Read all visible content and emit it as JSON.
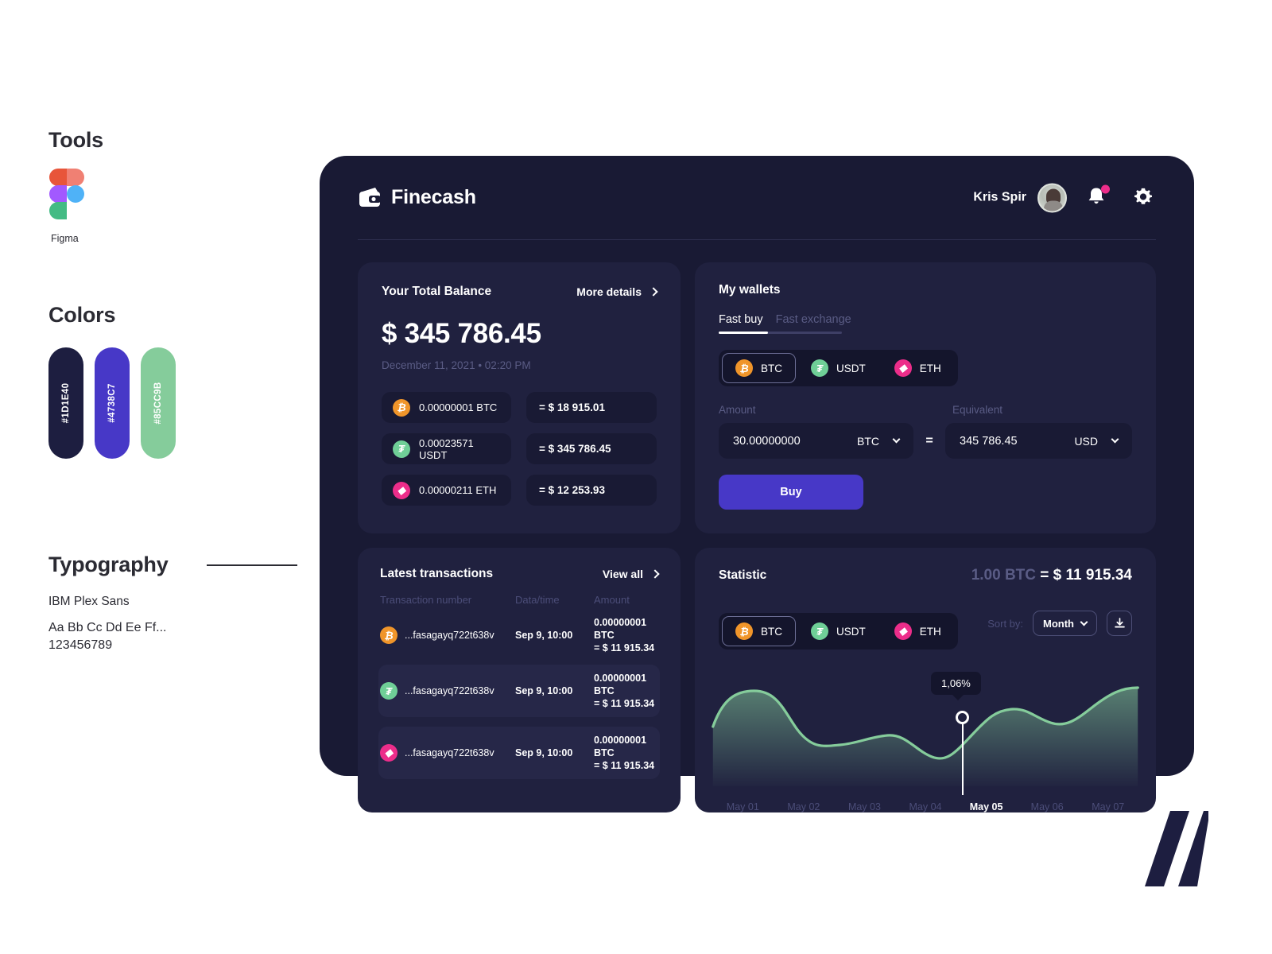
{
  "spec": {
    "tools_title": "Tools",
    "tool_name": "Figma",
    "colors_title": "Colors",
    "swatches": [
      {
        "hex": "#1D1E40",
        "label": "#1D1E40"
      },
      {
        "hex": "#4738C7",
        "label": "#4738C7"
      },
      {
        "hex": "#85CC9B",
        "label": "#85CC9B"
      }
    ],
    "typography_title": "Typography",
    "font_name": "IBM Plex Sans",
    "font_sample_line1": "Aa Bb Cc Dd Ee Ff...",
    "font_sample_line2": "123456789"
  },
  "header": {
    "brand": "Finecash",
    "user_name": "Kris Spir",
    "notification_badge": true
  },
  "balance": {
    "title": "Your Total Balance",
    "more_details": "More details",
    "amount": "$ 345 786.45",
    "datetime": "December 11, 2021 • 02:20 PM",
    "rows": [
      {
        "icon": "btc-icon",
        "symbol": "₿",
        "amount": "0.00000001 BTC",
        "equivalent": "= $ 18 915.01"
      },
      {
        "icon": "usdt-icon",
        "symbol": "₮",
        "amount": "0.00023571 USDT",
        "equivalent": "= $ 345 786.45"
      },
      {
        "icon": "eth-icon",
        "symbol": "◆",
        "amount": "0.00000211 ETH",
        "equivalent": "= $ 12 253.93"
      }
    ]
  },
  "wallets": {
    "title": "My wallets",
    "tabs": [
      {
        "label": "Fast buy",
        "active": true
      },
      {
        "label": "Fast exchange",
        "active": false
      }
    ],
    "coins": [
      {
        "label": "BTC",
        "symbol": "₿",
        "selected": true
      },
      {
        "label": "USDT",
        "symbol": "₮",
        "selected": false
      },
      {
        "label": "ETH",
        "symbol": "◆",
        "selected": false
      }
    ],
    "amount_label": "Amount",
    "equivalent_label": "Equivalent",
    "amount_value": "30.00000000",
    "amount_currency": "BTC",
    "equals": "=",
    "equivalent_value": "345 786.45",
    "equivalent_currency": "USD",
    "buy_label": "Buy"
  },
  "transactions": {
    "title": "Latest transactions",
    "view_all": "View all",
    "columns": [
      "Transaction number",
      "Data/time",
      "Amount"
    ],
    "rows": [
      {
        "icon": "btc-icon",
        "symbol": "₿",
        "number": "...fasagayq722t638v",
        "datetime": "Sep 9, 10:00",
        "amount_coin": "0.00000001 BTC",
        "amount_fiat": "= $ 11 915.34"
      },
      {
        "icon": "usdt-icon",
        "symbol": "₮",
        "number": "...fasagayq722t638v",
        "datetime": "Sep 9, 10:00",
        "amount_coin": "0.00000001 BTC",
        "amount_fiat": "= $ 11 915.34"
      },
      {
        "icon": "eth-icon",
        "symbol": "◆",
        "number": "...fasagayq722t638v",
        "datetime": "Sep 9, 10:00",
        "amount_coin": "0.00000001 BTC",
        "amount_fiat": "= $ 11 915.34"
      }
    ]
  },
  "statistic": {
    "title": "Statistic",
    "rate_prefix": "1.00 BTC ",
    "rate_value": "= $ 11 915.34",
    "coins": [
      {
        "label": "BTC",
        "symbol": "₿",
        "selected": true
      },
      {
        "label": "USDT",
        "symbol": "₮",
        "selected": false
      },
      {
        "label": "ETH",
        "symbol": "◆",
        "selected": false
      }
    ],
    "sort_label": "Sort by:",
    "sort_value": "Month",
    "download_icon": "download-icon",
    "tooltip_value": "1,06%"
  },
  "chart_data": {
    "type": "area",
    "title": "Statistic",
    "xlabel": "",
    "ylabel": "",
    "categories": [
      "May 01",
      "May 02",
      "May 03",
      "May 04",
      "May 05",
      "May 06",
      "May 07"
    ],
    "highlight_category": "May 05",
    "highlight_label": "1,06%",
    "series": [
      {
        "name": "BTC",
        "color": "#85CC9B",
        "values": [
          0.62,
          0.88,
          0.52,
          0.58,
          0.4,
          1.06,
          0.8,
          0.96
        ]
      }
    ],
    "x": [
      0,
      0.5,
      1.4,
      2.3,
      3.3,
      4.0,
      5.1,
      6.4
    ],
    "ylim": [
      0,
      1.25
    ],
    "grid": false,
    "legend": "none"
  }
}
